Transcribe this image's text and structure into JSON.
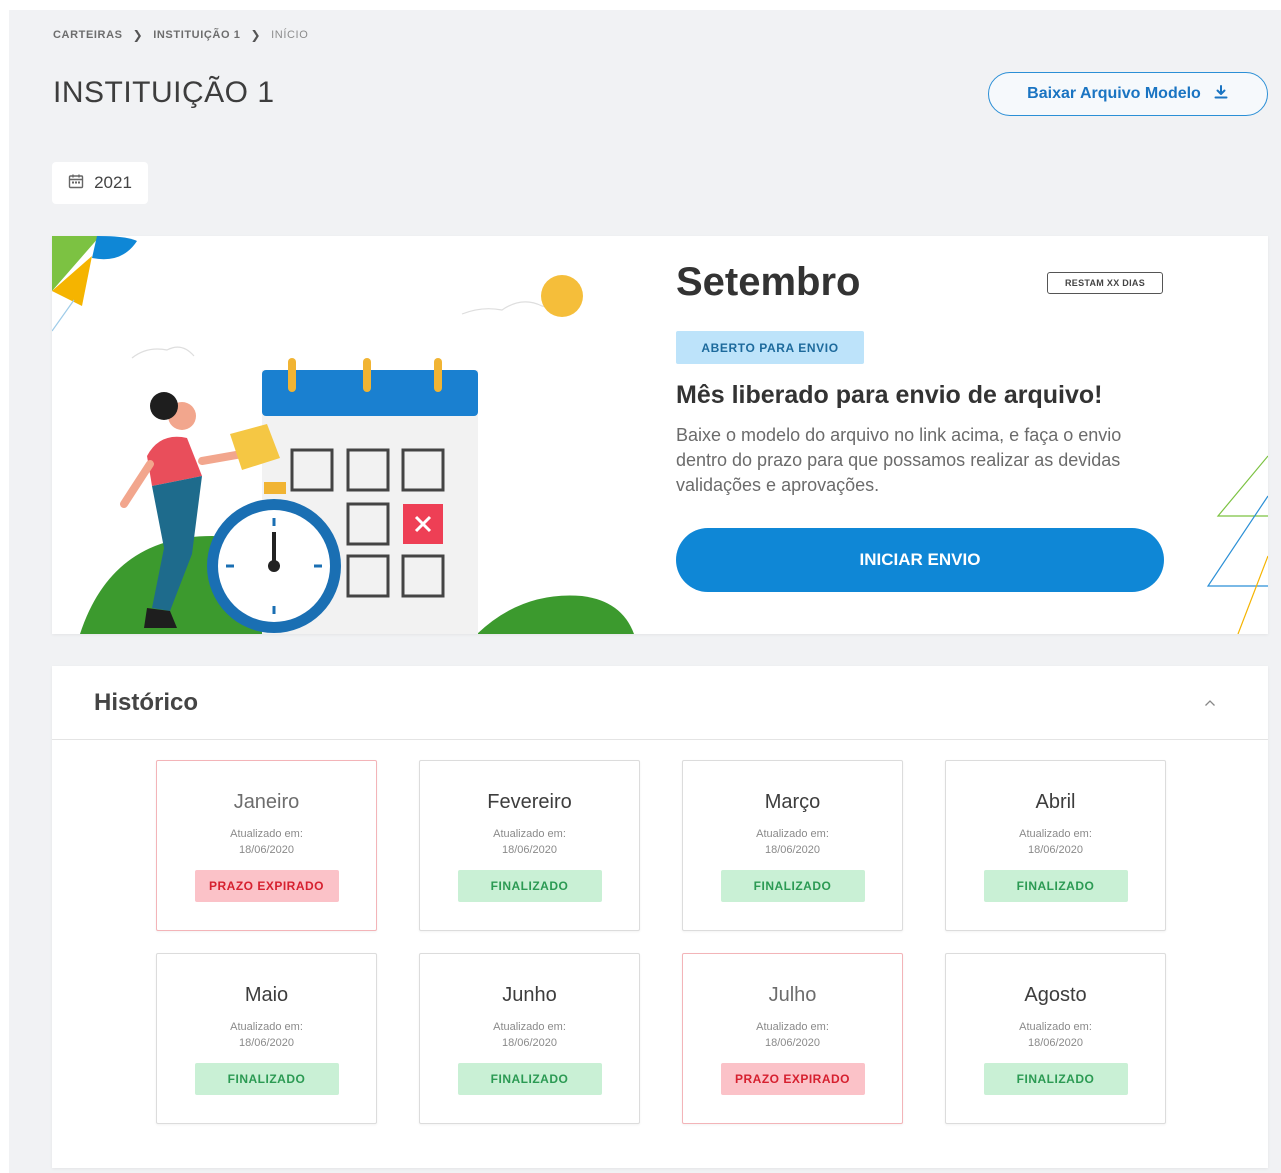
{
  "breadcrumb": {
    "items": [
      "CARTEIRAS",
      "INSTITUIÇÃO 1",
      "INÍCIO"
    ]
  },
  "page": {
    "title": "INSTITUIÇÃO 1",
    "download_button": "Baixar Arquivo Modelo",
    "year": "2021"
  },
  "hero": {
    "month": "Setembro",
    "days_left": "RESTAM XX DIAS",
    "status": "ABERTO PARA ENVIO",
    "heading": "Mês liberado para envio de arquivo!",
    "description": "Baixe o modelo do arquivo no link acima, e faça o envio dentro do prazo para que possamos realizar as devidas validações e aprovações.",
    "cta": "INICIAR ENVIO"
  },
  "history": {
    "title": "Histórico",
    "months": [
      {
        "name": "Janeiro",
        "updated_label": "Atualizado em:",
        "updated_date": "18/06/2020",
        "status": "PRAZO EXPIRADO",
        "state": "late"
      },
      {
        "name": "Fevereiro",
        "updated_label": "Atualizado em:",
        "updated_date": "18/06/2020",
        "status": "FINALIZADO",
        "state": "done"
      },
      {
        "name": "Março",
        "updated_label": "Atualizado em:",
        "updated_date": "18/06/2020",
        "status": "FINALIZADO",
        "state": "done"
      },
      {
        "name": "Abril",
        "updated_label": "Atualizado em:",
        "updated_date": "18/06/2020",
        "status": "FINALIZADO",
        "state": "done"
      },
      {
        "name": "Maio",
        "updated_label": "Atualizado em:",
        "updated_date": "18/06/2020",
        "status": "FINALIZADO",
        "state": "done"
      },
      {
        "name": "Junho",
        "updated_label": "Atualizado em:",
        "updated_date": "18/06/2020",
        "status": "FINALIZADO",
        "state": "done"
      },
      {
        "name": "Julho",
        "updated_label": "Atualizado em:",
        "updated_date": "18/06/2020",
        "status": "PRAZO EXPIRADO",
        "state": "late"
      },
      {
        "name": "Agosto",
        "updated_label": "Atualizado em:",
        "updated_date": "18/06/2020",
        "status": "FINALIZADO",
        "state": "done"
      }
    ]
  },
  "colors": {
    "primary": "#0f87d6",
    "finalizado_bg": "#c9f0d5",
    "finalizado_text": "#2b9a53",
    "expirado_bg": "#fbc2c8",
    "expirado_text": "#d6202f",
    "open_bg": "#bde3fa"
  },
  "icons": {
    "breadcrumb_separator": "chevron-right-icon",
    "download": "download-icon",
    "year": "calendar-icon",
    "collapse": "chevron-up-icon"
  }
}
